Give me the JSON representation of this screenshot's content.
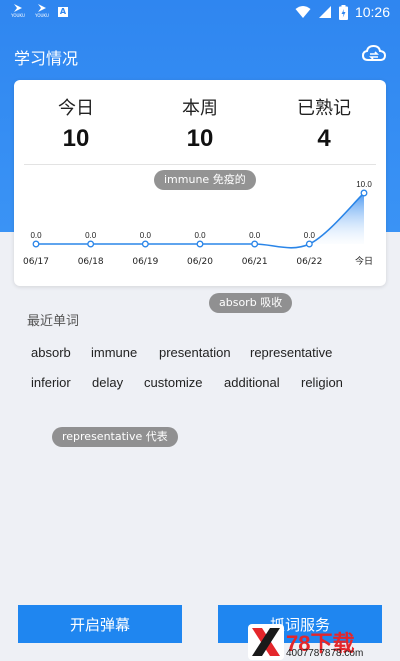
{
  "status_bar": {
    "time": "10:26",
    "app_icons": [
      {
        "icon": "youku-icon",
        "caption": "YOUKU"
      },
      {
        "icon": "youku-icon",
        "caption": "YOUKU"
      }
    ],
    "notification_letter": "A"
  },
  "header": {
    "title": "学习情况",
    "sync_icon": "cloud-sync-icon"
  },
  "stats": [
    {
      "label": "今日",
      "value": "10"
    },
    {
      "label": "本周",
      "value": "10"
    },
    {
      "label": "已熟记",
      "value": "4"
    }
  ],
  "chart_data": {
    "type": "area",
    "categories": [
      "06/17",
      "06/18",
      "06/19",
      "06/20",
      "06/21",
      "06/22",
      "今日"
    ],
    "values": [
      0,
      0,
      0,
      0,
      0,
      0,
      10
    ],
    "data_labels": [
      "0.0",
      "0.0",
      "0.0",
      "0.0",
      "0.0",
      "0.0",
      "10.0"
    ],
    "ylim": [
      0,
      10
    ],
    "grid": false,
    "colors": {
      "line": "#2a85e8",
      "fill_top": "#3a8ff0",
      "fill_bottom": "#ffffff"
    }
  },
  "floating_words": [
    {
      "word": "immune",
      "meaning": "免疫的"
    },
    {
      "word": "absorb",
      "meaning": "吸收"
    },
    {
      "word": "representative",
      "meaning": "代表"
    }
  ],
  "recent": {
    "title": "最近单词",
    "words": [
      "absorb",
      "immune",
      "presentation",
      "representative",
      "inferior",
      "delay",
      "customize",
      "additional",
      "religion"
    ]
  },
  "buttons": {
    "danmaku": "开启弹幕",
    "capture": "抓词服务"
  },
  "watermark": {
    "brand": "78下载",
    "url": "4007787878.com"
  }
}
